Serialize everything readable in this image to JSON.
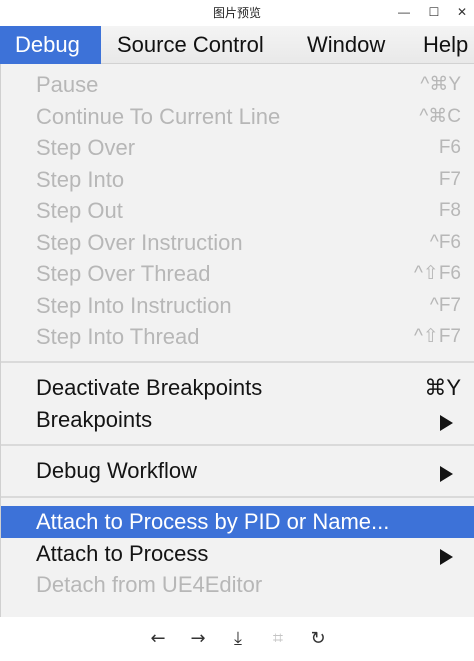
{
  "window": {
    "title": "图片预览",
    "minimize_glyph": "—",
    "maximize_glyph": "☐",
    "close_glyph": "✕"
  },
  "menubar": {
    "items": [
      "Debug",
      "Source Control",
      "Window",
      "Help"
    ],
    "active_index": 0
  },
  "menu": {
    "items": [
      {
        "label": "Pause",
        "shortcut": "^⌘Y",
        "enabled": false
      },
      {
        "label": "Continue To Current Line",
        "shortcut": "^⌘C",
        "enabled": false
      },
      {
        "label": "Step Over",
        "shortcut": "F6",
        "enabled": false
      },
      {
        "label": "Step Into",
        "shortcut": "F7",
        "enabled": false
      },
      {
        "label": "Step Out",
        "shortcut": "F8",
        "enabled": false
      },
      {
        "label": "Step Over Instruction",
        "shortcut": "^F6",
        "enabled": false
      },
      {
        "label": "Step Over Thread",
        "shortcut": "^⇧F6",
        "enabled": false
      },
      {
        "label": "Step Into Instruction",
        "shortcut": "^F7",
        "enabled": false
      },
      {
        "label": "Step Into Thread",
        "shortcut": "^⇧F7",
        "enabled": false
      },
      {
        "label": "Deactivate Breakpoints",
        "shortcut": "⌘Y",
        "enabled": true
      },
      {
        "label": "Breakpoints",
        "submenu": true,
        "enabled": true
      },
      {
        "label": "Debug Workflow",
        "submenu": true,
        "enabled": true
      },
      {
        "label": "Attach to Process by PID or Name...",
        "enabled": true,
        "highlighted": true
      },
      {
        "label": "Attach to Process",
        "submenu": true,
        "enabled": true
      },
      {
        "label": "Detach from UE4Editor",
        "enabled": false
      }
    ]
  },
  "toolbar": {
    "buttons": [
      {
        "name": "previous-icon",
        "glyph": "←",
        "enabled": true
      },
      {
        "name": "next-icon",
        "glyph": "→",
        "enabled": true
      },
      {
        "name": "download-icon",
        "glyph": "⤓",
        "enabled": true
      },
      {
        "name": "fit-to-screen-icon",
        "glyph": "⌗",
        "enabled": false
      },
      {
        "name": "rotate-icon",
        "glyph": "↻",
        "enabled": true
      }
    ]
  },
  "colors": {
    "highlight": "#3d72d8",
    "disabled_text": "#b7b7b7",
    "menu_bg": "#f2f2f2"
  }
}
